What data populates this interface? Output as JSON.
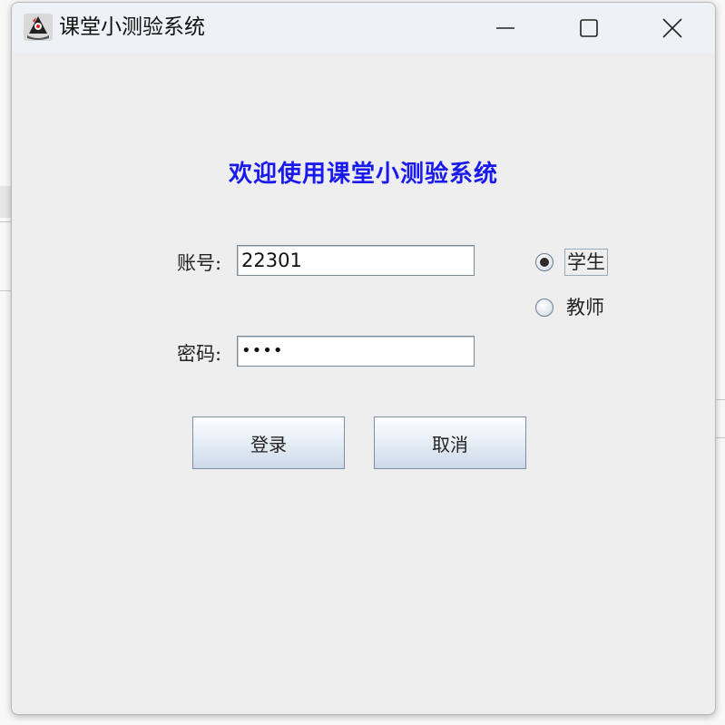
{
  "window": {
    "title": "课堂小测验系统",
    "app_icon": "java-duke-icon",
    "controls": {
      "minimize": "minimize-icon",
      "maximize": "maximize-icon",
      "close": "close-icon"
    }
  },
  "form": {
    "heading": "欢迎使用课堂小测验系统",
    "account_label": "账号:",
    "account_value": "22301",
    "password_label": "密码:",
    "password_value": "••••",
    "roles": [
      {
        "label": "学生",
        "selected": true
      },
      {
        "label": "教师",
        "selected": false
      }
    ],
    "login_button": "登录",
    "cancel_button": "取消"
  },
  "colors": {
    "heading": "#1a1aee",
    "window_bg": "#eeeeee",
    "titlebar_bg": "#eef1f5"
  }
}
